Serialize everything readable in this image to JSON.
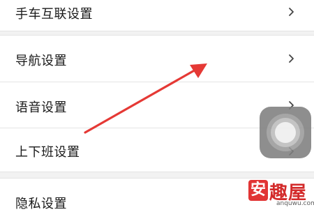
{
  "settings_list": {
    "items": [
      {
        "label": "手车互联设置",
        "has_chevron": true
      },
      {
        "label": "导航设置",
        "has_chevron": true
      },
      {
        "label": "语音设置",
        "has_chevron": true
      },
      {
        "label": "上下班设置",
        "has_chevron": true
      },
      {
        "label": "隐私设置",
        "has_chevron": false
      }
    ]
  },
  "icons": {
    "chevron": "chevron-right-icon",
    "assistive_touch": "assistive-touch-icon",
    "annotation_arrow": "red-arrow-annotation"
  },
  "watermark": {
    "badge": "安",
    "text": "趣屋",
    "url": "anquwu.com"
  },
  "colors": {
    "arrow": "#e53935",
    "watermark": "#d12020"
  }
}
